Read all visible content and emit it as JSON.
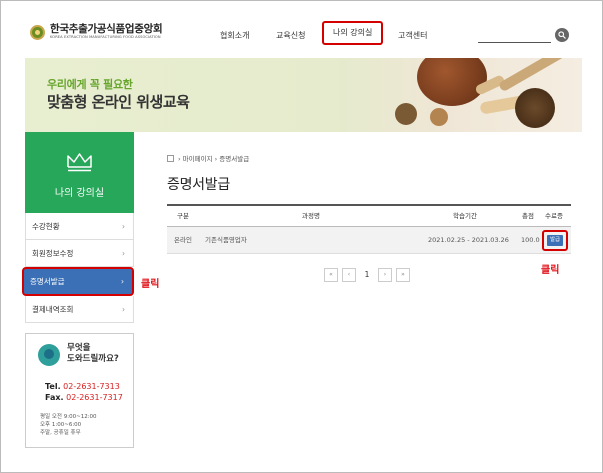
{
  "header": {
    "logo_title": "한국추출가공식품업중앙회",
    "logo_subtitle": "KOREA EXTRACTION MANUFACTURING FOOD ASSOCIATION",
    "nav": [
      "협회소개",
      "교육신청",
      "나의 강의실",
      "고객센터"
    ],
    "active_nav": "나의 강의실",
    "search_placeholder": ""
  },
  "banner": {
    "line1": "우리에게 꼭 필요한",
    "line2": "맞춤형 온라인 위생교육"
  },
  "sidebar": {
    "title": "나의 강의실",
    "items": [
      {
        "label": "수강현황"
      },
      {
        "label": "회원정보수정"
      },
      {
        "label": "증명서발급"
      },
      {
        "label": "결제내역조회"
      }
    ],
    "selected": "증명서발급",
    "chevron": "›"
  },
  "help": {
    "question_line1": "무엇을",
    "question_line2": "도와드릴까요?",
    "tel_label": "Tel.",
    "tel": "02-2631-7313",
    "fax_label": "Fax.",
    "fax": "02-2631-7317",
    "hours": [
      "평일 오전 9:00~12:00",
      "오후 1:00~6:00",
      "주말, 공휴일 휴무"
    ]
  },
  "annotations": {
    "click_sidebar": "클릭",
    "click_issue": "클릭"
  },
  "content": {
    "breadcrumb": "› 마이페이지 › 증명서발급",
    "title": "증명서발급",
    "table": {
      "headers": [
        "구분",
        "과정명",
        "학습기간",
        "총점",
        "수료증"
      ],
      "rows": [
        {
          "type": "온라인",
          "course": "기존식품영업자",
          "period": "2021.02.25 - 2021.03.26",
          "score": "100.0",
          "action": "발급"
        }
      ]
    },
    "pagination": {
      "first": "«",
      "prev": "‹",
      "current": "1",
      "next": "›",
      "last": "»"
    }
  },
  "colors": {
    "accent_green": "#27a75a",
    "accent_blue": "#3b70b6",
    "highlight_red": "#d40000"
  }
}
